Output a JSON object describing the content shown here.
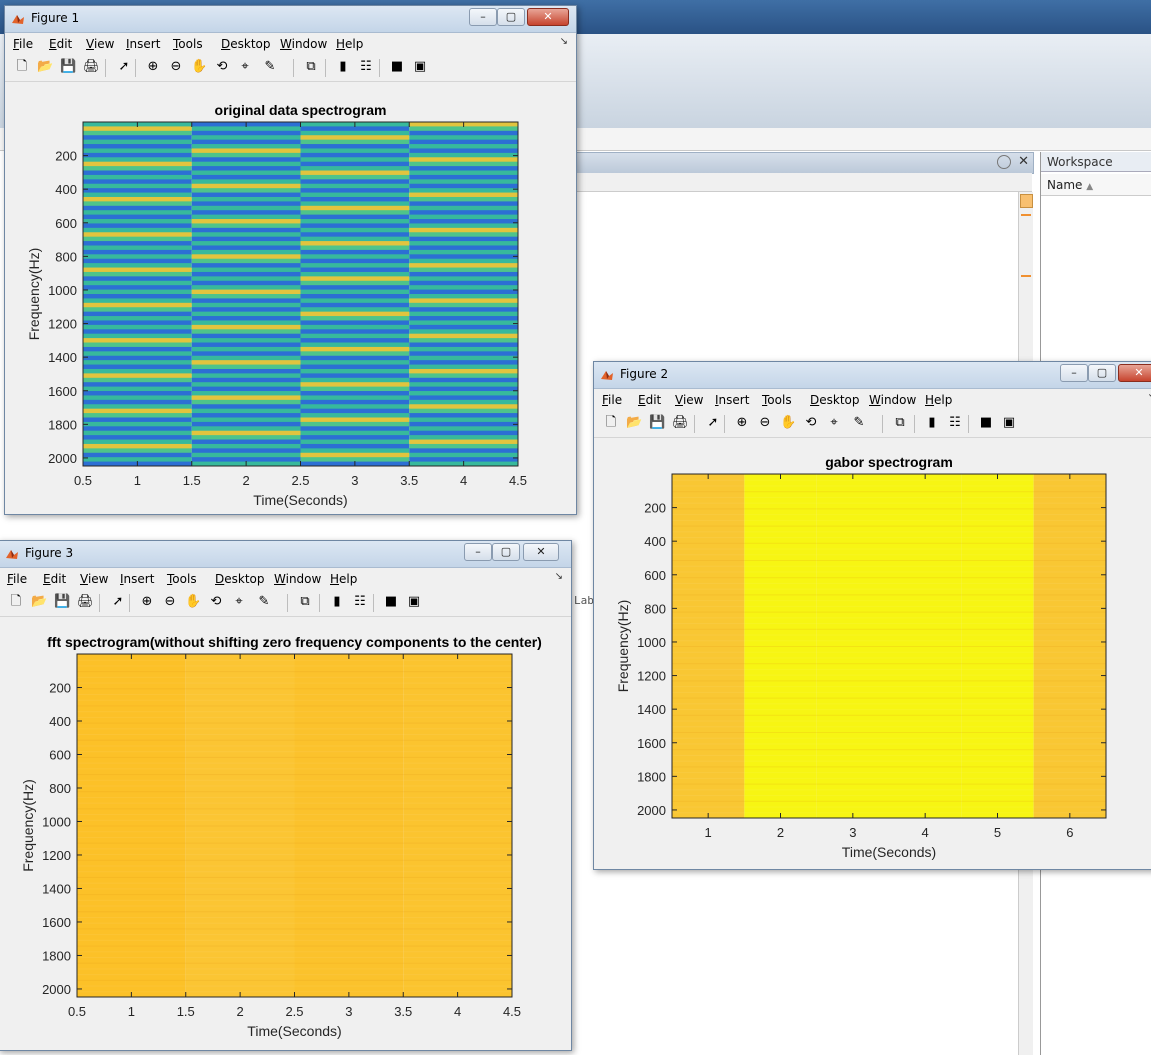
{
  "desktop": {
    "panel_sub_text": "",
    "workspace_title": "Workspace",
    "workspace_col": "Name",
    "ghost_text": "Lab"
  },
  "menu": [
    "File",
    "Edit",
    "View",
    "Insert",
    "Tools",
    "Desktop",
    "Window",
    "Help"
  ],
  "icons": [
    "new-figure-icon",
    "open-icon",
    "save-icon",
    "print-icon",
    "select-arrow-icon",
    "zoom-in-icon",
    "zoom-out-icon",
    "pan-hand-icon",
    "rotate-3d-icon",
    "data-cursor-icon",
    "brush-icon",
    "link-plot-icon",
    "colorbar-icon",
    "legend-icon",
    "hide-tools-icon",
    "show-tools-icon"
  ],
  "figures": [
    {
      "id": "fig1",
      "title": "Figure 1"
    },
    {
      "id": "fig2",
      "title": "Figure 2"
    },
    {
      "id": "fig3",
      "title": "Figure 3"
    }
  ],
  "chart_data": [
    {
      "figure": "Figure 1",
      "type": "heatmap",
      "title": "original data spectrogram",
      "xlabel": "Time(Seconds)",
      "ylabel": "Frequency(Hz)",
      "xlim": [
        0.5,
        4.5
      ],
      "ylim": [
        0,
        2048
      ],
      "y_reversed": true,
      "xticks": [
        "0.5",
        "1",
        "1.5",
        "2",
        "2.5",
        "3",
        "3.5",
        "4",
        "4.5"
      ],
      "yticks": [
        "200",
        "400",
        "600",
        "800",
        "1000",
        "1200",
        "1400",
        "1600",
        "1800",
        "2000"
      ],
      "x": [
        1,
        2,
        3,
        4
      ],
      "colormap": "parula",
      "pattern": "horizontal stripes of teal, blue and yellow alternating along frequency in each 1-second column"
    },
    {
      "figure": "Figure 2",
      "type": "heatmap",
      "title": "gabor spectrogram",
      "xlabel": "Time(Seconds)",
      "ylabel": "Frequency(Hz)",
      "xlim": [
        0.5,
        6.5
      ],
      "ylim": [
        0,
        2048
      ],
      "y_reversed": true,
      "xticks": [
        "1",
        "2",
        "3",
        "4",
        "5",
        "6"
      ],
      "yticks": [
        "200",
        "400",
        "600",
        "800",
        "1000",
        "1200",
        "1400",
        "1600",
        "1800",
        "2000"
      ],
      "x": [
        1,
        2,
        3,
        4,
        5,
        6
      ],
      "column_colors": [
        "#f9c733",
        "#f7f513",
        "#f7f513",
        "#f7f513",
        "#f7f513",
        "#f9c733"
      ],
      "colormap": "parula"
    },
    {
      "figure": "Figure 3",
      "type": "heatmap",
      "title": "fft spectrogram(without shifting zero frequency components to the center)",
      "xlabel": "Time(Seconds)",
      "ylabel": "Frequency(Hz)",
      "xlim": [
        0.5,
        4.5
      ],
      "ylim": [
        0,
        2048
      ],
      "y_reversed": true,
      "xticks": [
        "0.5",
        "1",
        "1.5",
        "2",
        "2.5",
        "3",
        "3.5",
        "4",
        "4.5"
      ],
      "yticks": [
        "200",
        "400",
        "600",
        "800",
        "1000",
        "1200",
        "1400",
        "1600",
        "1800",
        "2000"
      ],
      "x": [
        1,
        2,
        3,
        4
      ],
      "column_colors": [
        "#fcc128",
        "#fbc533",
        "#fbc22c",
        "#fbc42f"
      ],
      "colormap": "parula"
    }
  ],
  "colors": {
    "teal": "#37b99c",
    "blue": "#2c6fd4",
    "yellow": "#e2c43e",
    "parula_yellow": "#f7f513",
    "parula_orange": "#f9c733"
  }
}
